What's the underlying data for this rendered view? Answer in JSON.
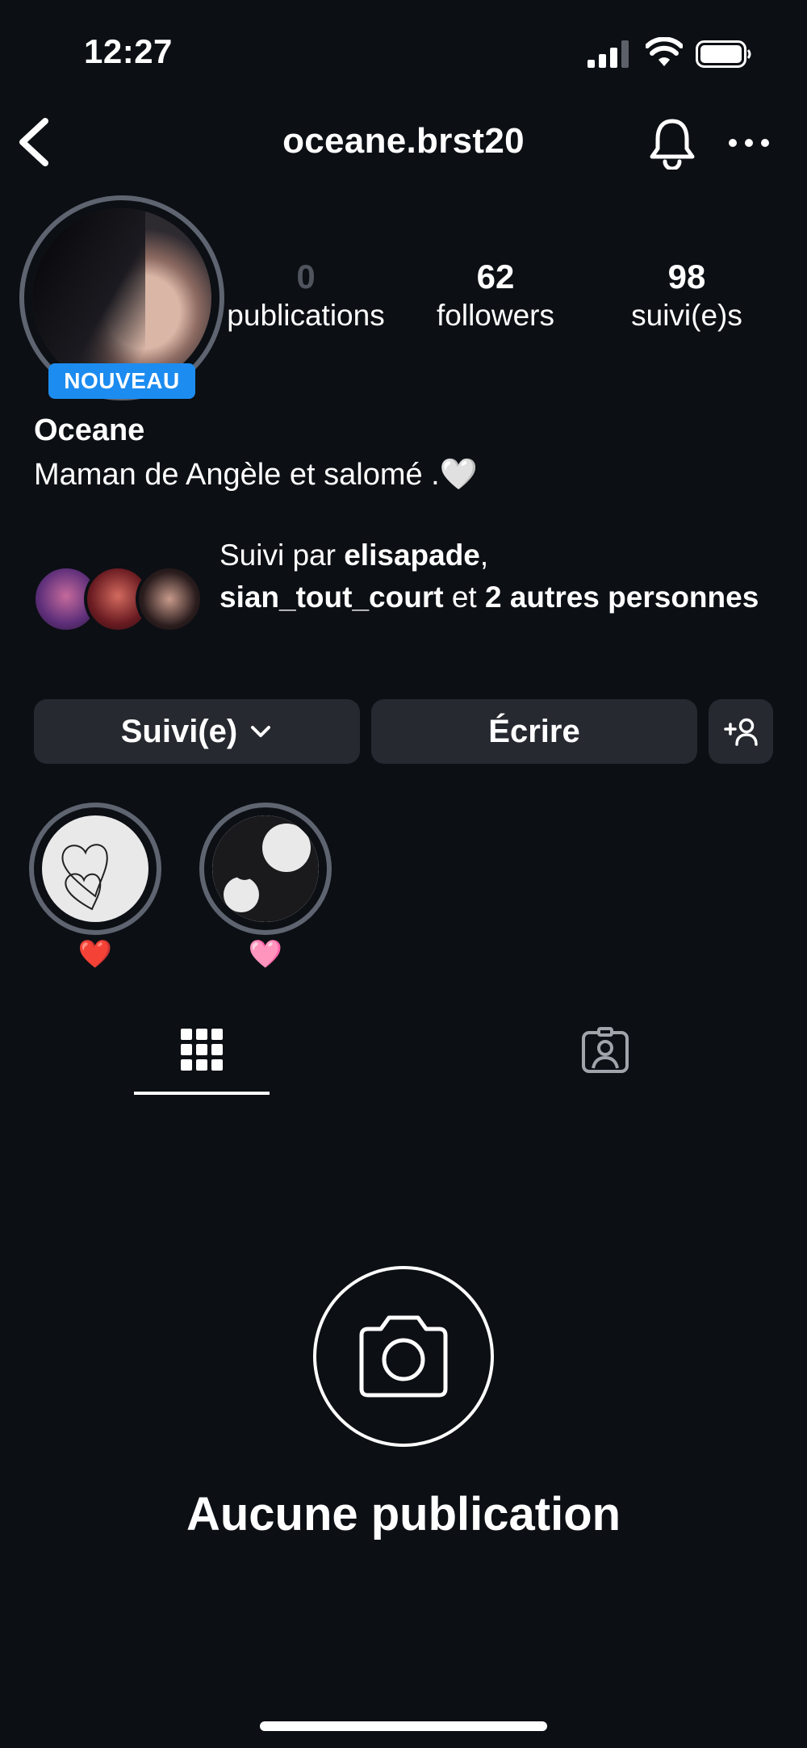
{
  "status_bar": {
    "time": "12:27"
  },
  "header": {
    "username": "oceane.brst20"
  },
  "profile": {
    "badge": "NOUVEAU",
    "stats": [
      {
        "value": "0",
        "label": "publications"
      },
      {
        "value": "62",
        "label": "followers"
      },
      {
        "value": "98",
        "label": "suivi(e)s"
      }
    ],
    "display_name": "Oceane",
    "bio": "Maman de Angèle et salomé .🤍"
  },
  "followed_by": {
    "prefix": "Suivi par ",
    "user1": "elisapade",
    "sep1": ",",
    "user2": "sian_tout_court",
    "connector": " et ",
    "others": "2 autres personnes"
  },
  "actions": {
    "follow_label": "Suivi(e)",
    "write_label": "Écrire"
  },
  "highlights": [
    {
      "label": "❤️"
    },
    {
      "label": "🩷"
    }
  ],
  "empty_state": {
    "title": "Aucune publication"
  }
}
